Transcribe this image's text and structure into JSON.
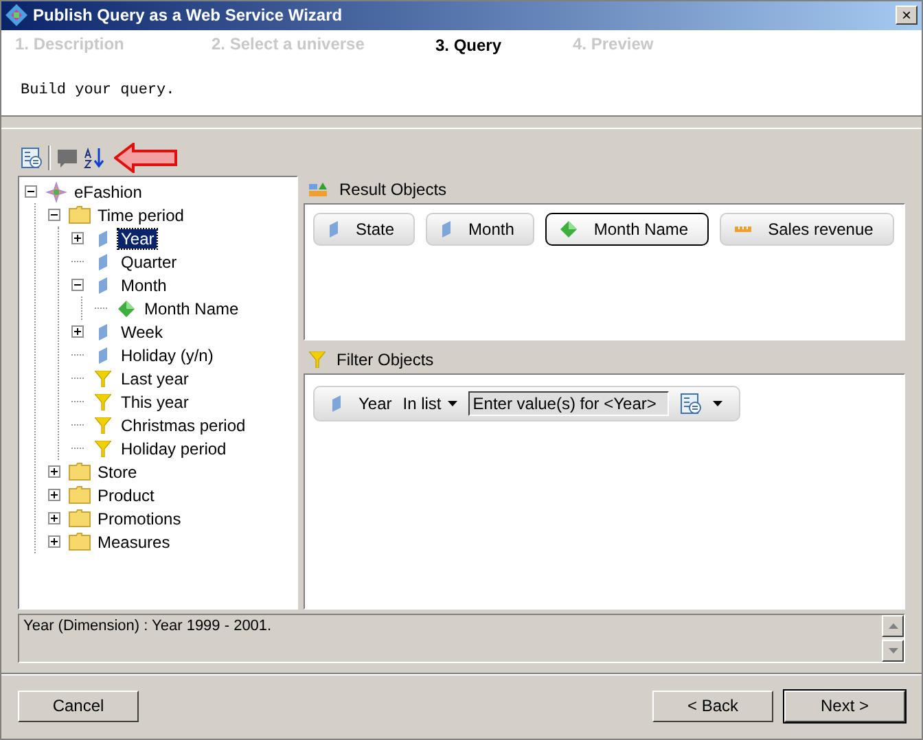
{
  "window": {
    "title": "Publish Query as a Web Service Wizard",
    "close": "×"
  },
  "steps": [
    {
      "label": "1. Description",
      "selected": false
    },
    {
      "label": "2. Select a universe",
      "selected": false
    },
    {
      "label": "3. Query",
      "selected": true
    },
    {
      "label": "4. Preview",
      "selected": false
    }
  ],
  "description": "Build your query.",
  "tree": [
    {
      "label": "eFashion",
      "kind": "universe",
      "expanded": true,
      "selected": false,
      "children": [
        {
          "label": "Time period",
          "kind": "folder",
          "expanded": true,
          "selected": false,
          "children": [
            {
              "label": "Year",
              "kind": "dimension",
              "expanded": false,
              "selected": true
            },
            {
              "label": "Quarter",
              "kind": "dimension",
              "selected": false
            },
            {
              "label": "Month",
              "kind": "dimension",
              "expanded": true,
              "selected": false,
              "children": [
                {
                  "label": "Month Name",
                  "kind": "detail",
                  "selected": false
                }
              ]
            },
            {
              "label": "Week",
              "kind": "dimension",
              "expanded": false,
              "selected": false
            },
            {
              "label": "Holiday (y/n)",
              "kind": "dimension",
              "selected": false
            },
            {
              "label": "Last year",
              "kind": "filter",
              "selected": false
            },
            {
              "label": "This year",
              "kind": "filter",
              "selected": false
            },
            {
              "label": "Christmas period",
              "kind": "filter",
              "selected": false
            },
            {
              "label": "Holiday period",
              "kind": "filter",
              "selected": false
            }
          ]
        },
        {
          "label": "Store",
          "kind": "folder",
          "expanded": false,
          "selected": false
        },
        {
          "label": "Product",
          "kind": "folder",
          "expanded": false,
          "selected": false
        },
        {
          "label": "Promotions",
          "kind": "folder",
          "expanded": false,
          "selected": false
        },
        {
          "label": "Measures",
          "kind": "folder",
          "expanded": false,
          "selected": false
        }
      ]
    }
  ],
  "result_objects": {
    "title": "Result Objects",
    "items": [
      {
        "label": "State",
        "kind": "dimension",
        "selected": false
      },
      {
        "label": "Month",
        "kind": "dimension",
        "selected": false
      },
      {
        "label": "Month Name",
        "kind": "detail",
        "selected": true
      },
      {
        "label": "Sales revenue",
        "kind": "measure",
        "selected": false
      }
    ]
  },
  "filter_objects": {
    "title": "Filter Objects",
    "filters": [
      {
        "object": "Year",
        "kind": "dimension",
        "operator": "In list",
        "value": "Enter value(s) for <Year>"
      }
    ]
  },
  "status_text": "Year (Dimension) : Year 1999 - 2001.",
  "buttons": {
    "cancel": "Cancel",
    "back": "< Back",
    "next": "Next >"
  }
}
